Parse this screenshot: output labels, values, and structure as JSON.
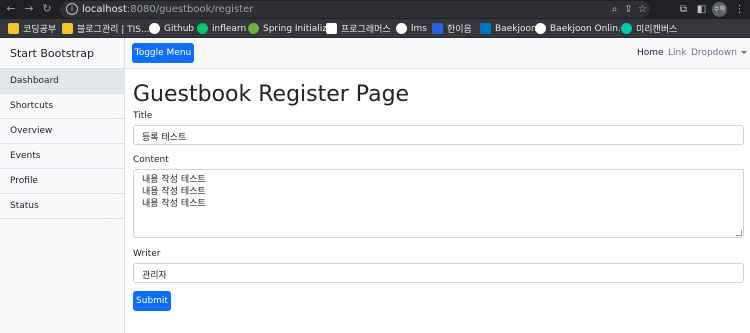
{
  "browser": {
    "url_host": "localhost",
    "url_rest": ":8080/guestbook/register",
    "profile_label": "수혁",
    "bookmarks": [
      {
        "label": "코딩공부",
        "color": "#f1c232"
      },
      {
        "label": "블로그관리 | TIS...",
        "color": "#f1c232"
      },
      {
        "label": "Github",
        "color": "#ffffff"
      },
      {
        "label": "inflearn",
        "color": "#00c471"
      },
      {
        "label": "Spring Initializr",
        "color": "#6db33f"
      },
      {
        "label": "프로그래머스",
        "color": "#ffffff"
      },
      {
        "label": "lms",
        "color": "#ffffff"
      },
      {
        "label": "한이음",
        "color": "#2a61e2"
      },
      {
        "label": "Baekjoon",
        "color": "#0076c0"
      },
      {
        "label": "Baekjoon Onlin...",
        "color": "#ffffff"
      },
      {
        "label": "미리캔버스",
        "color": "#00c7ae"
      }
    ]
  },
  "sidebar": {
    "brand": "Start Bootstrap",
    "items": [
      {
        "label": "Dashboard",
        "active": true
      },
      {
        "label": "Shortcuts",
        "active": false
      },
      {
        "label": "Overview",
        "active": false
      },
      {
        "label": "Events",
        "active": false
      },
      {
        "label": "Profile",
        "active": false
      },
      {
        "label": "Status",
        "active": false
      }
    ]
  },
  "topnav": {
    "toggle_label": "Toggle Menu",
    "home": "Home",
    "link": "Link",
    "dropdown": "Dropdown"
  },
  "form": {
    "heading": "Guestbook Register Page",
    "title_label": "Title",
    "title_value": "등록 테스트",
    "content_label": "Content",
    "content_lines": [
      "내용 작성 테스트",
      "내용 작성 테스트",
      "내용 작성 테스트"
    ],
    "writer_label": "Writer",
    "writer_value": "관리자",
    "submit_label": "Submit"
  },
  "colors": {
    "primary": "#0d6efd",
    "sidebar_bg": "#f8f9fa",
    "active_item_bg": "#e4e7ea"
  }
}
